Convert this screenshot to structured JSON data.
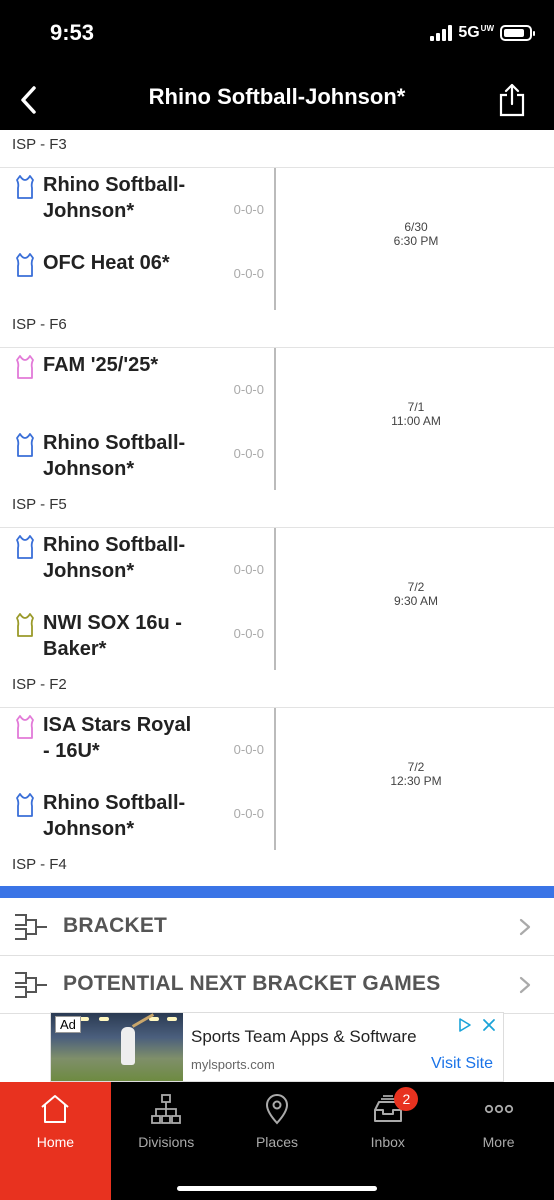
{
  "status": {
    "time": "9:53",
    "network": "5G",
    "network_suffix": "UW"
  },
  "header": {
    "title": "Rhino Softball-Johnson*"
  },
  "top_field": "ISP - F3",
  "games": [
    {
      "team_a": {
        "name": "Rhino Softball-Johnson*",
        "record": "0-0-0",
        "color": "#3a6fd8"
      },
      "team_b": {
        "name": "OFC Heat 06*",
        "record": "0-0-0",
        "color": "#3a6fd8"
      },
      "date": "6/30",
      "time": "6:30 PM",
      "field": "ISP - F6"
    },
    {
      "team_a": {
        "name": "FAM '25/'25*",
        "record": "0-0-0",
        "color": "#e27ad8"
      },
      "team_b": {
        "name": "Rhino Softball-Johnson*",
        "record": "0-0-0",
        "color": "#3a6fd8"
      },
      "date": "7/1",
      "time": "11:00 AM",
      "field": "ISP - F5"
    },
    {
      "team_a": {
        "name": "Rhino Softball-Johnson*",
        "record": "0-0-0",
        "color": "#3a6fd8"
      },
      "team_b": {
        "name": "NWI SOX 16u - Baker*",
        "record": "0-0-0",
        "color": "#9a9a2a"
      },
      "date": "7/2",
      "time": "9:30 AM",
      "field": "ISP - F2"
    },
    {
      "team_a": {
        "name": "ISA Stars Royal - 16U*",
        "record": "0-0-0",
        "color": "#e27ad8"
      },
      "team_b": {
        "name": "Rhino Softball-Johnson*",
        "record": "0-0-0",
        "color": "#3a6fd8"
      },
      "date": "7/2",
      "time": "12:30 PM",
      "field": "ISP - F4"
    }
  ],
  "links": {
    "bracket": "BRACKET",
    "next_games": "POTENTIAL NEXT BRACKET GAMES"
  },
  "ad": {
    "badge": "Ad",
    "title": "Sports Team Apps & Software",
    "url": "mylsports.com",
    "cta": "Visit Site"
  },
  "tabs": [
    {
      "label": "Home",
      "icon": "home-icon",
      "active": true
    },
    {
      "label": "Divisions",
      "icon": "hierarchy-icon"
    },
    {
      "label": "Places",
      "icon": "map-pin-icon"
    },
    {
      "label": "Inbox",
      "icon": "inbox-icon",
      "badge": "2"
    },
    {
      "label": "More",
      "icon": "more-icon"
    }
  ],
  "colors": {
    "accent": "#e8321f",
    "strip": "#3a74e6",
    "bar": "#000000"
  }
}
